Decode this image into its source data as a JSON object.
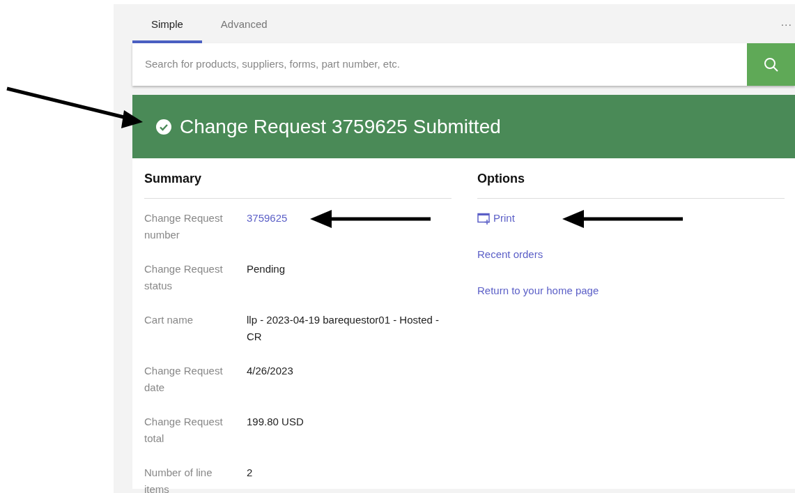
{
  "tabs": [
    {
      "label": "Simple",
      "selected": true
    },
    {
      "label": "Advanced",
      "selected": false
    }
  ],
  "more_menu": "...",
  "search": {
    "placeholder": "Search for products, suppliers, forms, part number, etc."
  },
  "banner": {
    "title": "Change Request 3759625 Submitted"
  },
  "summary": {
    "heading": "Summary",
    "fields": [
      {
        "label": "Change Request number",
        "value": "3759625",
        "kind": "link"
      },
      {
        "label": "Change Request status",
        "value": "Pending",
        "kind": "text"
      },
      {
        "label": "Cart name",
        "value": "llp - 2023-04-19 barequestor01 - Hosted - CR",
        "kind": "text"
      },
      {
        "label": "Change Request date",
        "value": "4/26/2023",
        "kind": "text"
      },
      {
        "label": "Change Request total",
        "value": "199.80 USD",
        "kind": "text"
      },
      {
        "label": "Number of line items",
        "value": "2",
        "kind": "text"
      }
    ]
  },
  "options": {
    "heading": "Options",
    "links": [
      {
        "label": "Print",
        "kind": "print"
      },
      {
        "label": "Recent orders",
        "kind": "plain"
      },
      {
        "label": "Return to your home page",
        "kind": "plain"
      }
    ]
  }
}
